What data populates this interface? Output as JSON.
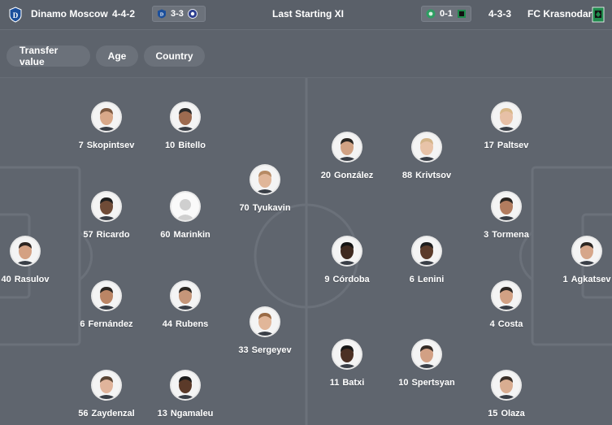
{
  "header": {
    "home_team": "Dinamo Moscow",
    "home_formation": "4-4-2",
    "home_score": "3-3",
    "title": "Last Starting XI",
    "away_score": "0-1",
    "away_formation": "4-3-3",
    "away_team": "FC Krasnodar"
  },
  "filters": [
    "Transfer value",
    "Age",
    "Country"
  ],
  "players": [
    {
      "num": "7",
      "name": "Skopintsev",
      "side": "home",
      "face": "#d8a889",
      "hair": "#7e5a41"
    },
    {
      "num": "10",
      "name": "Bitello",
      "side": "home",
      "face": "#9d6b50",
      "hair": "#2b2b2b"
    },
    {
      "num": "70",
      "name": "Tyukavin",
      "side": "home",
      "face": "#e0b699",
      "hair": "#b68a64"
    },
    {
      "num": "57",
      "name": "Ricardo",
      "side": "home",
      "face": "#6f4b37",
      "hair": "#1e1e1e"
    },
    {
      "num": "60",
      "name": "Marinkin",
      "side": "home",
      "face": "placeholder",
      "hair": "#cfcfcf"
    },
    {
      "num": "40",
      "name": "Rasulov",
      "side": "home",
      "face": "#d4a183",
      "hair": "#2d2521"
    },
    {
      "num": "6",
      "name": "Fernández",
      "side": "home",
      "face": "#bb8565",
      "hair": "#2a2520"
    },
    {
      "num": "44",
      "name": "Rubens",
      "side": "home",
      "face": "#c59679",
      "hair": "#2a2520"
    },
    {
      "num": "33",
      "name": "Sergeyev",
      "side": "home",
      "face": "#e1b699",
      "hair": "#9a6b46"
    },
    {
      "num": "56",
      "name": "Zaydenzal",
      "side": "home",
      "face": "#e0b49b",
      "hair": "#5a4534"
    },
    {
      "num": "13",
      "name": "Ngamaleu",
      "side": "home",
      "face": "#5b3a29",
      "hair": "#1b1b1b"
    },
    {
      "num": "20",
      "name": "González",
      "side": "away",
      "face": "#d1a284",
      "hair": "#2a2622"
    },
    {
      "num": "88",
      "name": "Krivtsov",
      "side": "away",
      "face": "#e8c3a8",
      "hair": "#d4b58a"
    },
    {
      "num": "17",
      "name": "Paltsev",
      "side": "away",
      "face": "#e7c0a6",
      "hair": "#d9b889"
    },
    {
      "num": "3",
      "name": "Tormena",
      "side": "away",
      "face": "#b27c5f",
      "hair": "#2a2521"
    },
    {
      "num": "9",
      "name": "Córdoba",
      "side": "away",
      "face": "#3f2a20",
      "hair": "#141414"
    },
    {
      "num": "6",
      "name": "Lenini",
      "side": "away",
      "face": "#5b3b2a",
      "hair": "#1e1e1e"
    },
    {
      "num": "1",
      "name": "Agkatsev",
      "side": "away",
      "face": "#d6a68a",
      "hair": "#2d2723"
    },
    {
      "num": "4",
      "name": "Costa",
      "side": "away",
      "face": "#d2a184",
      "hair": "#2b2622"
    },
    {
      "num": "11",
      "name": "Batxi",
      "side": "away",
      "face": "#4b3024",
      "hair": "#171717"
    },
    {
      "num": "10",
      "name": "Spertsyan",
      "side": "away",
      "face": "#d2a084",
      "hair": "#332a24"
    },
    {
      "num": "15",
      "name": "Olaza",
      "side": "away",
      "face": "#d9ad91",
      "hair": "#3a2f27"
    }
  ],
  "colors": {
    "background": "#5f656e",
    "pitch_lines": "#6b717a",
    "chip": "#6b717a",
    "dinamo_blue": "#1b4f9c",
    "krasnodar_green": "#1f8a4c"
  }
}
